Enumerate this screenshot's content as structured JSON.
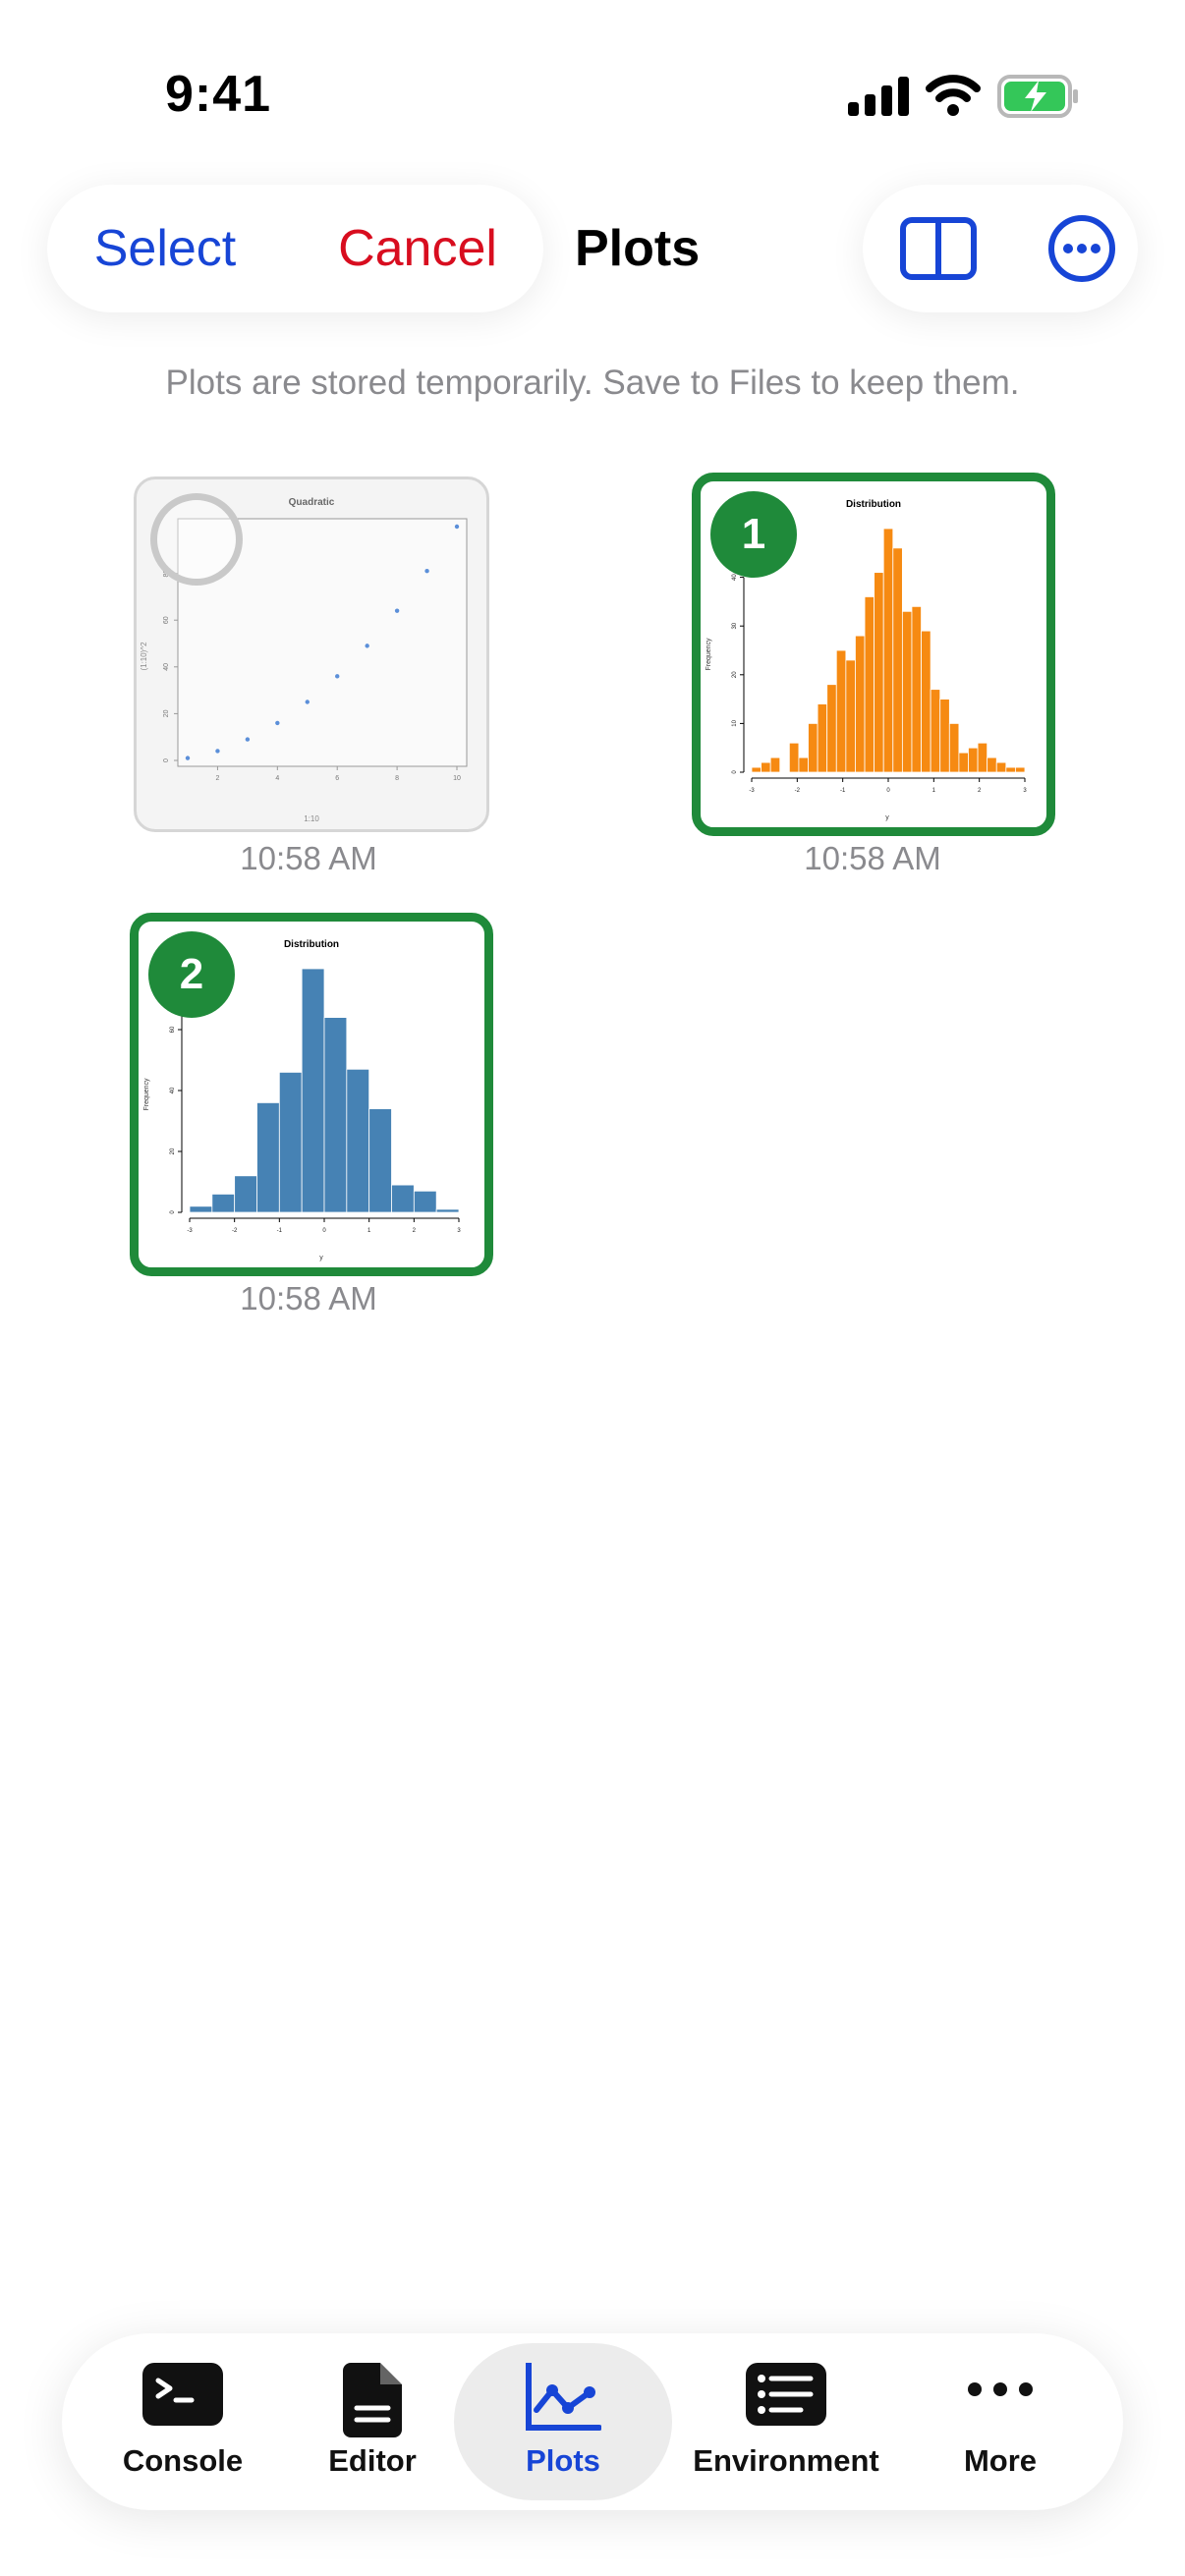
{
  "status_bar": {
    "time": "9:41"
  },
  "header": {
    "select_label": "Select",
    "cancel_label": "Cancel",
    "title": "Plots",
    "colors": {
      "select": "#1745d6",
      "cancel": "#d80d1f"
    }
  },
  "notice": "Plots are stored temporarily. Save to Files to keep them.",
  "plots": [
    {
      "time": "10:58 AM",
      "selected": false,
      "chart_title": "Quadratic",
      "y_label": "(1:10)^2",
      "x_label": "1:10"
    },
    {
      "time": "10:58 AM",
      "selected": true,
      "selection_number": "1",
      "chart_title": "Distribution",
      "y_label": "Frequency",
      "x_label": "y",
      "color": "#f68a12"
    },
    {
      "time": "10:58 AM",
      "selected": true,
      "selection_number": "2",
      "chart_title": "Distribution",
      "y_label": "Frequency",
      "x_label": "y",
      "color": "#4682b4"
    }
  ],
  "chart_data": [
    {
      "type": "scatter",
      "title": "Quadratic",
      "xlabel": "1:10",
      "ylabel": "(1:10)^2",
      "x": [
        1,
        2,
        3,
        4,
        5,
        6,
        7,
        8,
        9,
        10
      ],
      "y": [
        1,
        4,
        9,
        16,
        25,
        36,
        49,
        64,
        81,
        100
      ],
      "xlim": [
        1,
        10
      ],
      "ylim": [
        0,
        100
      ],
      "x_ticks": [
        "2",
        "4",
        "6",
        "8",
        "10"
      ],
      "y_ticks": [
        "0",
        "20",
        "40",
        "60",
        "80"
      ]
    },
    {
      "type": "bar",
      "title": "Distribution",
      "xlabel": "y",
      "ylabel": "Frequency",
      "xlim": [
        -3,
        3
      ],
      "ylim": [
        0,
        50
      ],
      "x_ticks": [
        "-3",
        "-2",
        "-1",
        "0",
        "1",
        "2",
        "3"
      ],
      "y_ticks": [
        "0",
        "10",
        "20",
        "30",
        "40"
      ],
      "values": [
        1,
        2,
        3,
        0,
        6,
        3,
        10,
        14,
        18,
        25,
        23,
        28,
        36,
        41,
        50,
        46,
        33,
        34,
        29,
        17,
        15,
        10,
        4,
        5,
        6,
        3,
        2,
        1,
        1
      ],
      "color": "#f68a12"
    },
    {
      "type": "bar",
      "title": "Distribution",
      "xlabel": "y",
      "ylabel": "Frequency",
      "xlim": [
        -3,
        3
      ],
      "ylim": [
        0,
        80
      ],
      "x_ticks": [
        "-3",
        "-2",
        "-1",
        "0",
        "1",
        "2",
        "3"
      ],
      "y_ticks": [
        "0",
        "20",
        "40",
        "60",
        "80"
      ],
      "values": [
        2,
        6,
        12,
        36,
        46,
        80,
        64,
        47,
        34,
        9,
        7,
        1
      ],
      "color": "#4682b4"
    }
  ],
  "tabs": [
    {
      "label": "Console",
      "icon": "terminal-icon"
    },
    {
      "label": "Editor",
      "icon": "document-icon"
    },
    {
      "label": "Plots",
      "icon": "chart-icon",
      "active": true
    },
    {
      "label": "Environment",
      "icon": "list-icon"
    },
    {
      "label": "More",
      "icon": "ellipsis-icon"
    }
  ]
}
